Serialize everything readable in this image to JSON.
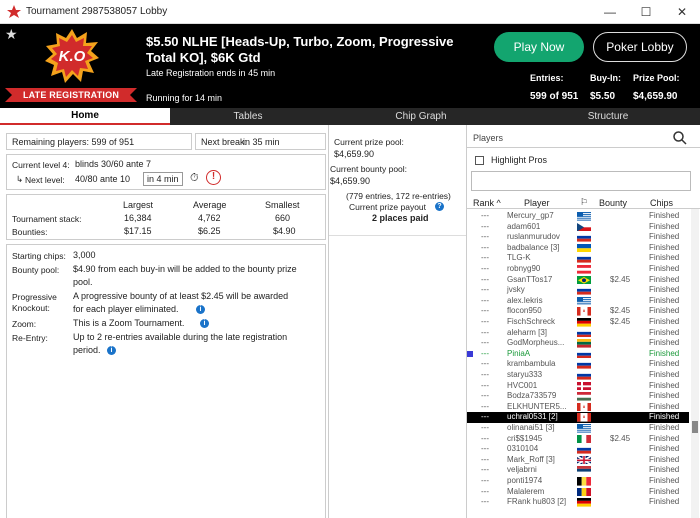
{
  "window": {
    "title": "Tournament 2987538057 Lobby",
    "minimize": "—",
    "maximize": "☐",
    "close": "✕"
  },
  "header": {
    "title": "$5.50 NLHE [Heads-Up, Turbo, Zoom, Progressive Total KO], $6K Gtd",
    "logo_text": "K.O",
    "late_registration_ends": "Late Registration ends in 45 min",
    "running_for": "Running for 14 min",
    "late_registration_banner": "LATE REGISTRATION",
    "play_now": "Play Now",
    "poker_lobby": "Poker Lobby",
    "entries_label": "Entries:",
    "entries_value": "599 of 951",
    "buyin_label": "Buy-In:",
    "buyin_value": "$5.50",
    "prizepool_label": "Prize Pool:",
    "prizepool_value": "$4,659.90",
    "accent_green": "#13a56f",
    "accent_red": "#d12b2b"
  },
  "tabs": [
    "Home",
    "Tables",
    "Chip Graph",
    "Structure"
  ],
  "home": {
    "remaining_players": "Remaining players: 599 of 951",
    "next_break_label": "Next break:",
    "next_break_value": "in 35 min",
    "current_level": "Current level 4:",
    "current_blinds": "blinds 30/60 ante 7",
    "next_level_label": "Next level:",
    "next_level_value": "40/80 ante 10",
    "next_level_time": "in 4 min",
    "stack_headers": [
      "Largest",
      "Average",
      "Smallest"
    ],
    "tournament_stack_label": "Tournament stack:",
    "tournament_stack": [
      "16,384",
      "4,762",
      "660"
    ],
    "bounties_label": "Bounties:",
    "bounties": [
      "$17.15",
      "$6.25",
      "$4.90"
    ],
    "starting_chips_label": "Starting chips:",
    "starting_chips": "3,000",
    "bounty_pool_label": "Bounty pool:",
    "bounty_pool_line1": "$4.90 from each buy-in will be added to the bounty prize",
    "bounty_pool_line2": "pool.",
    "pko_label1": "Progressive",
    "pko_label2": "Knockout:",
    "pko_line1": "A progressive bounty of at least $2.45 will be awarded",
    "pko_line2": "for each player eliminated.",
    "zoom_label": "Zoom:",
    "zoom_text": "This is a Zoom Tournament.",
    "reentry_label": "Re-Entry:",
    "reentry_line1": "Up to 2 re-entries available during the late registration",
    "reentry_line2": "period."
  },
  "middle": {
    "current_prize_pool_label": "Current prize pool:",
    "current_prize_pool": "$4,659.90",
    "current_bounty_pool_label": "Current bounty pool:",
    "current_bounty_pool": "$4,659.90",
    "entries_note": "(779 entries, 172 re-entries)",
    "payout_label": "Current prize payout",
    "places_paid": "2 places paid"
  },
  "players": {
    "section_label": "Players",
    "highlight_pros": "Highlight Pros",
    "search_value": "",
    "columns": [
      "Rank",
      "Player",
      "",
      "Bounty",
      "Chips"
    ],
    "rows": [
      {
        "rank": "---",
        "name": "Mercury_gp7",
        "bounty": "",
        "status": "Finished",
        "flag": "gr"
      },
      {
        "rank": "---",
        "name": "adam601",
        "bounty": "",
        "status": "Finished",
        "flag": "cz"
      },
      {
        "rank": "---",
        "name": "ruslanmurudov",
        "bounty": "",
        "status": "Finished",
        "flag": "ru"
      },
      {
        "rank": "---",
        "name": "badbalance [3]",
        "bounty": "",
        "status": "Finished",
        "flag": "ua"
      },
      {
        "rank": "---",
        "name": "TLG-K",
        "bounty": "",
        "status": "Finished",
        "flag": "ru"
      },
      {
        "rank": "---",
        "name": "robnyg90",
        "bounty": "",
        "status": "Finished",
        "flag": "at"
      },
      {
        "rank": "---",
        "name": "GsanTTos17",
        "bounty": "$2.45",
        "status": "Finished",
        "flag": "br"
      },
      {
        "rank": "---",
        "name": "jvsky",
        "bounty": "",
        "status": "Finished",
        "flag": "ru"
      },
      {
        "rank": "---",
        "name": "alex.lekris",
        "bounty": "",
        "status": "Finished",
        "flag": "gr"
      },
      {
        "rank": "---",
        "name": "flocon950",
        "bounty": "$2.45",
        "status": "Finished",
        "flag": "ca"
      },
      {
        "rank": "---",
        "name": "FischSchreck",
        "bounty": "$2.45",
        "status": "Finished",
        "flag": "de"
      },
      {
        "rank": "---",
        "name": "aleharm [3]",
        "bounty": "",
        "status": "Finished",
        "flag": "ru"
      },
      {
        "rank": "---",
        "name": "GodMorpheus...",
        "bounty": "",
        "status": "Finished",
        "flag": "lt"
      },
      {
        "rank": "---",
        "name": "PiniaA",
        "bounty": "",
        "status": "Finished",
        "flag": "ru"
      },
      {
        "rank": "---",
        "name": "krambambula",
        "bounty": "",
        "status": "Finished",
        "flag": "ru"
      },
      {
        "rank": "---",
        "name": "staryu333",
        "bounty": "",
        "status": "Finished",
        "flag": "ru"
      },
      {
        "rank": "---",
        "name": "HVC001",
        "bounty": "",
        "status": "Finished",
        "flag": "dk"
      },
      {
        "rank": "---",
        "name": "Bodza733579",
        "bounty": "",
        "status": "Finished",
        "flag": "hu"
      },
      {
        "rank": "---",
        "name": "ELKHUNTER5...",
        "bounty": "",
        "status": "Finished",
        "flag": "ca"
      },
      {
        "rank": "---",
        "name": "uchral0531 [2]",
        "bounty": "",
        "status": "Finished",
        "flag": "ca"
      },
      {
        "rank": "---",
        "name": "olinanai51 [3]",
        "bounty": "",
        "status": "Finished",
        "flag": "gr"
      },
      {
        "rank": "---",
        "name": "cri$$1945",
        "bounty": "$2.45",
        "status": "Finished",
        "flag": "it"
      },
      {
        "rank": "---",
        "name": "0310104",
        "bounty": "",
        "status": "Finished",
        "flag": "ru"
      },
      {
        "rank": "---",
        "name": "Mark_Roff [3]",
        "bounty": "",
        "status": "Finished",
        "flag": "gb"
      },
      {
        "rank": "---",
        "name": "veljabrni",
        "bounty": "",
        "status": "Finished",
        "flag": "rs"
      },
      {
        "rank": "---",
        "name": "ponti1974",
        "bounty": "",
        "status": "Finished",
        "flag": "be"
      },
      {
        "rank": "---",
        "name": "Malalerem",
        "bounty": "",
        "status": "Finished",
        "flag": "ro"
      },
      {
        "rank": "---",
        "name": "FRank hu803 [2]",
        "bounty": "",
        "status": "Finished",
        "flag": "de"
      }
    ]
  }
}
